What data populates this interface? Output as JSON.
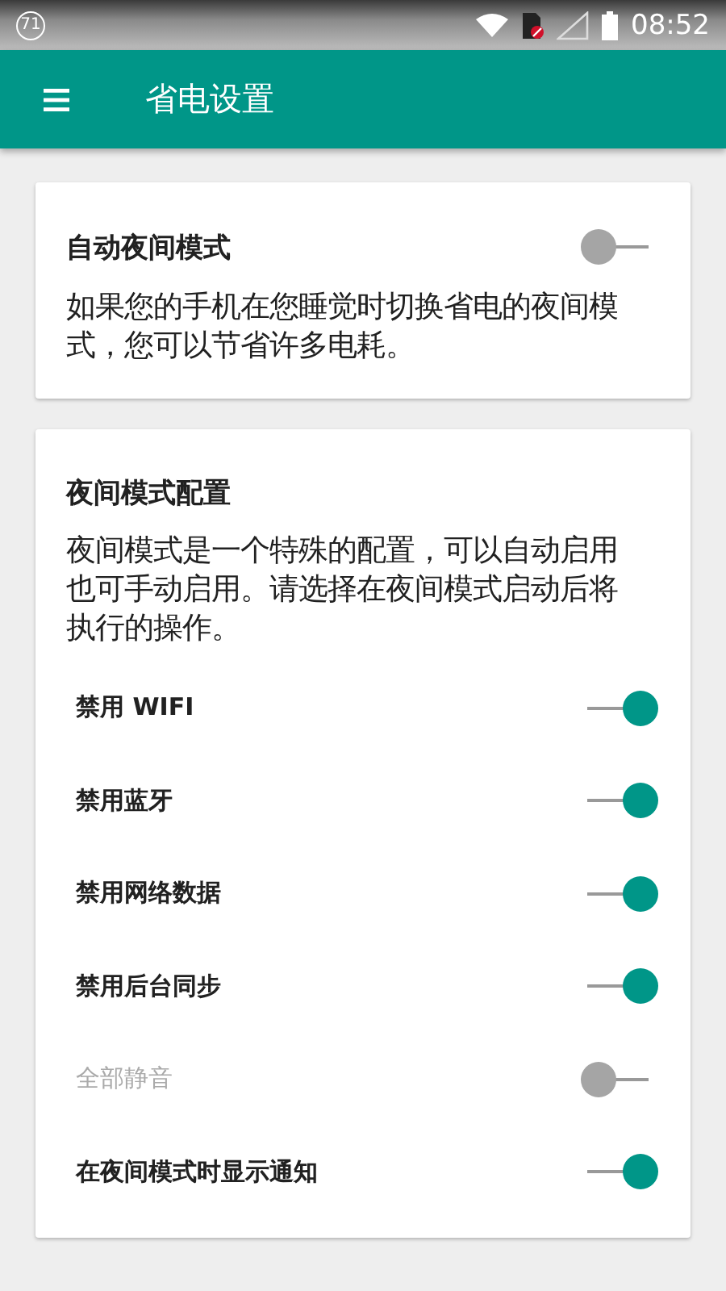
{
  "status_bar": {
    "notification_count": "71",
    "time": "08:52"
  },
  "app_bar": {
    "title": "省电设置"
  },
  "cards": [
    {
      "title": "自动夜间模式",
      "title_switch": {
        "on": false
      },
      "description": "如果您的手机在您睡觉时切换省电的夜间模式，您可以节省许多电耗。"
    },
    {
      "title": "夜间模式配置",
      "description": "夜间模式是一个特殊的配置，可以自动启用也可手动启用。请选择在夜间模式启动后将执行的操作。",
      "settings": [
        {
          "label": "禁用 WIFI",
          "on": true,
          "disabled": false
        },
        {
          "label": "禁用蓝牙",
          "on": true,
          "disabled": false
        },
        {
          "label": "禁用网络数据",
          "on": true,
          "disabled": false
        },
        {
          "label": "禁用后台同步",
          "on": true,
          "disabled": false
        },
        {
          "label": "全部静音",
          "on": false,
          "disabled": true
        },
        {
          "label": "在夜间模式时显示通知",
          "on": true,
          "disabled": false
        }
      ]
    }
  ]
}
